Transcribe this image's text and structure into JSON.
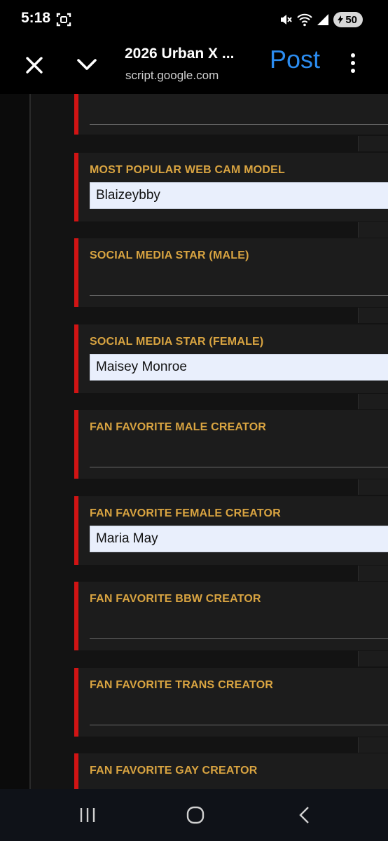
{
  "status_bar": {
    "time": "5:18",
    "battery_level": "50"
  },
  "toolbar": {
    "title": "2026 Urban X ...",
    "url": "script.google.com",
    "post_label": "Post"
  },
  "form": {
    "cards": [
      {
        "label": "",
        "value": ""
      },
      {
        "label": "MOST POPULAR WEB CAM MODEL",
        "value": "Blaizeybby"
      },
      {
        "label": "SOCIAL MEDIA STAR (MALE)",
        "value": ""
      },
      {
        "label": "SOCIAL MEDIA STAR (FEMALE)",
        "value": "Maisey Monroe"
      },
      {
        "label": "FAN FAVORITE MALE CREATOR",
        "value": ""
      },
      {
        "label": "FAN FAVORITE FEMALE CREATOR",
        "value": "Maria May"
      },
      {
        "label": "FAN FAVORITE BBW CREATOR",
        "value": ""
      },
      {
        "label": "FAN FAVORITE TRANS CREATOR",
        "value": ""
      },
      {
        "label": "FAN FAVORITE GAY CREATOR",
        "value": ""
      }
    ]
  },
  "colors": {
    "accent_red": "#d11414",
    "label_gold": "#d9a441",
    "post_blue": "#2b8cf0"
  },
  "icons": {
    "toolbar": [
      "close-icon",
      "chevron-down-icon",
      "more-vert-icon"
    ],
    "status": [
      "screenshot-icon",
      "mute-icon",
      "wifi-icon",
      "signal-icon",
      "battery-icon"
    ],
    "nav": [
      "recents-icon",
      "home-icon",
      "back-icon"
    ]
  }
}
